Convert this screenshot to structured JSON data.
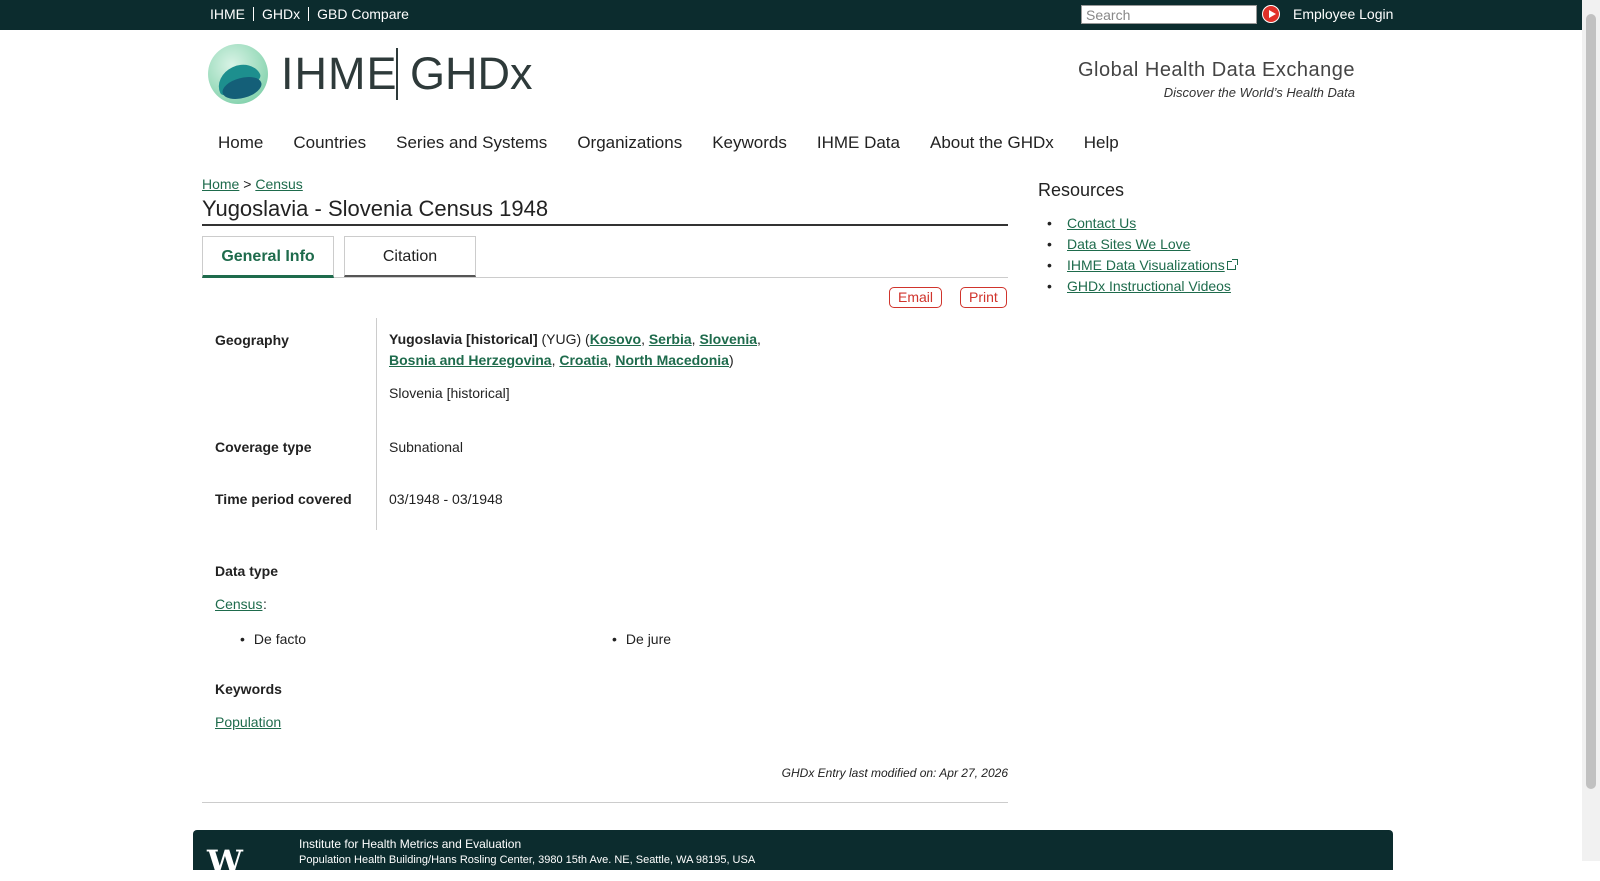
{
  "topbar": {
    "links": [
      "IHME",
      "GHDx",
      "GBD Compare"
    ],
    "search_placeholder": "Search",
    "login": "Employee Login"
  },
  "header": {
    "logo_left": "IHME",
    "logo_right": "GHDx",
    "tagline_title": "Global Health Data Exchange",
    "tagline_sub": "Discover the World’s Health Data"
  },
  "nav": [
    "Home",
    "Countries",
    "Series and Systems",
    "Organizations",
    "Keywords",
    "IHME Data",
    "About the GHDx",
    "Help"
  ],
  "breadcrumb": {
    "home": "Home",
    "sep": ">",
    "section": "Census"
  },
  "page_title": "Yugoslavia - Slovenia Census 1948",
  "tabs": {
    "general": "General Info",
    "citation": "Citation"
  },
  "actions": {
    "email": "Email",
    "print": "Print"
  },
  "fields": {
    "geography_label": "Geography",
    "geo_main": "Yugoslavia [historical]",
    "geo_code": "(YUG) (",
    "geo_links": [
      "Kosovo",
      "Serbia",
      "Slovenia",
      "Bosnia and Herzegovina",
      "Croatia",
      "North Macedonia"
    ],
    "geo_sub": "Slovenia [historical]",
    "coverage_label": "Coverage type",
    "coverage_value": "Subnational",
    "time_label": "Time period covered",
    "time_value": "03/1948 - 03/1948"
  },
  "data_type": {
    "label": "Data type",
    "link": "Census",
    "items": [
      "De facto",
      "De jure"
    ]
  },
  "keywords": {
    "label": "Keywords",
    "link": "Population"
  },
  "modified": "GHDx Entry last modified on: Apr 27, 2026",
  "resources": {
    "title": "Resources",
    "items": [
      "Contact Us",
      "Data Sites We Love",
      "IHME Data Visualizations",
      "GHDx Instructional Videos"
    ]
  },
  "footer": {
    "logo": "W",
    "line1": "Institute for Health Metrics and Evaluation",
    "line2": "Population Health Building/Hans Rosling Center, 3980 15th Ave. NE, Seattle, WA 98195, USA"
  }
}
